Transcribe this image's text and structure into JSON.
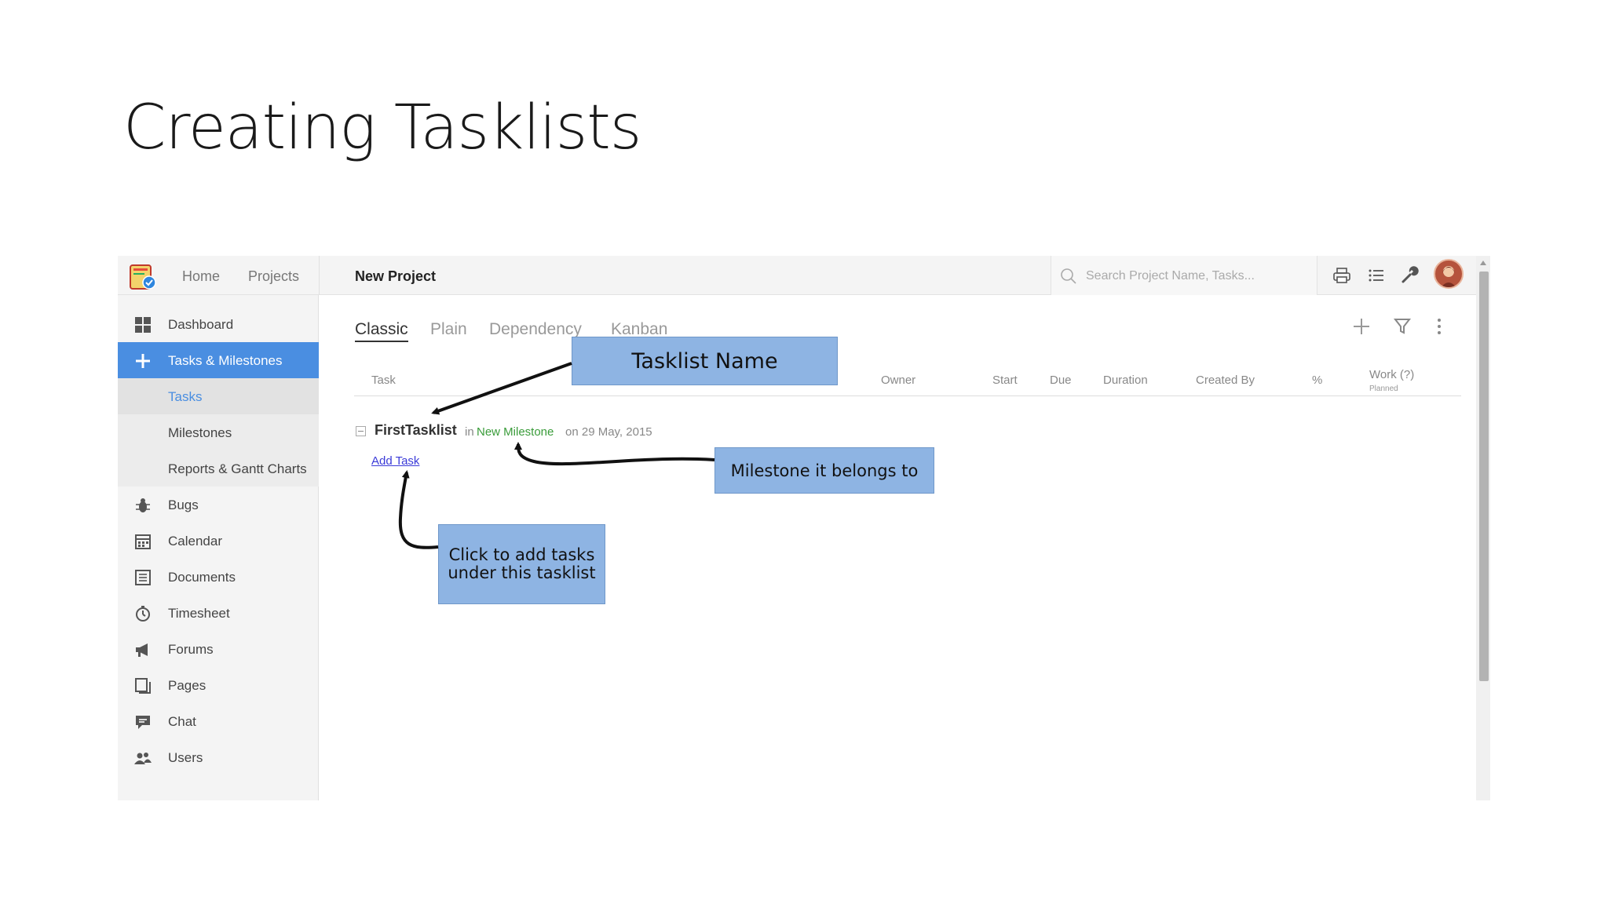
{
  "slide": {
    "title": "Creating Tasklists"
  },
  "topbar": {
    "nav": [
      "Home",
      "Projects"
    ],
    "project_name": "New Project",
    "search_placeholder": "Search Project Name, Tasks..."
  },
  "sidebar": {
    "items": [
      {
        "label": "Dashboard",
        "icon": "dashboard-icon"
      },
      {
        "label": "Tasks & Milestones",
        "icon": "plus-icon"
      },
      {
        "label": "Tasks"
      },
      {
        "label": "Milestones"
      },
      {
        "label": "Reports & Gantt Charts"
      },
      {
        "label": "Bugs",
        "icon": "bug-icon"
      },
      {
        "label": "Calendar",
        "icon": "calendar-icon"
      },
      {
        "label": "Documents",
        "icon": "document-icon"
      },
      {
        "label": "Timesheet",
        "icon": "stopwatch-icon"
      },
      {
        "label": "Forums",
        "icon": "megaphone-icon"
      },
      {
        "label": "Pages",
        "icon": "pages-icon"
      },
      {
        "label": "Chat",
        "icon": "chat-icon"
      },
      {
        "label": "Users",
        "icon": "users-icon"
      }
    ]
  },
  "main": {
    "view_tabs": [
      "Classic",
      "Plain",
      "Dependency",
      "Kanban"
    ],
    "columns": [
      "Task",
      "Owner",
      "Start",
      "Due",
      "Duration",
      "Created By",
      "%",
      "Work (?)"
    ],
    "work_sub": "Planned",
    "tasklist": {
      "name": "FirstTasklist",
      "in_text": "in",
      "milestone": "New Milestone",
      "date_text": "on 29 May, 2015",
      "add_task": "Add Task"
    }
  },
  "callouts": {
    "tasklist_name": "Tasklist Name",
    "milestone": "Milestone it belongs to",
    "add_task": "Click to add tasks under this tasklist"
  },
  "colors": {
    "accent": "#4a8ee1",
    "callout": "#8eb4e3",
    "milestone": "#3a9c3a",
    "link": "#3b3bd8"
  }
}
